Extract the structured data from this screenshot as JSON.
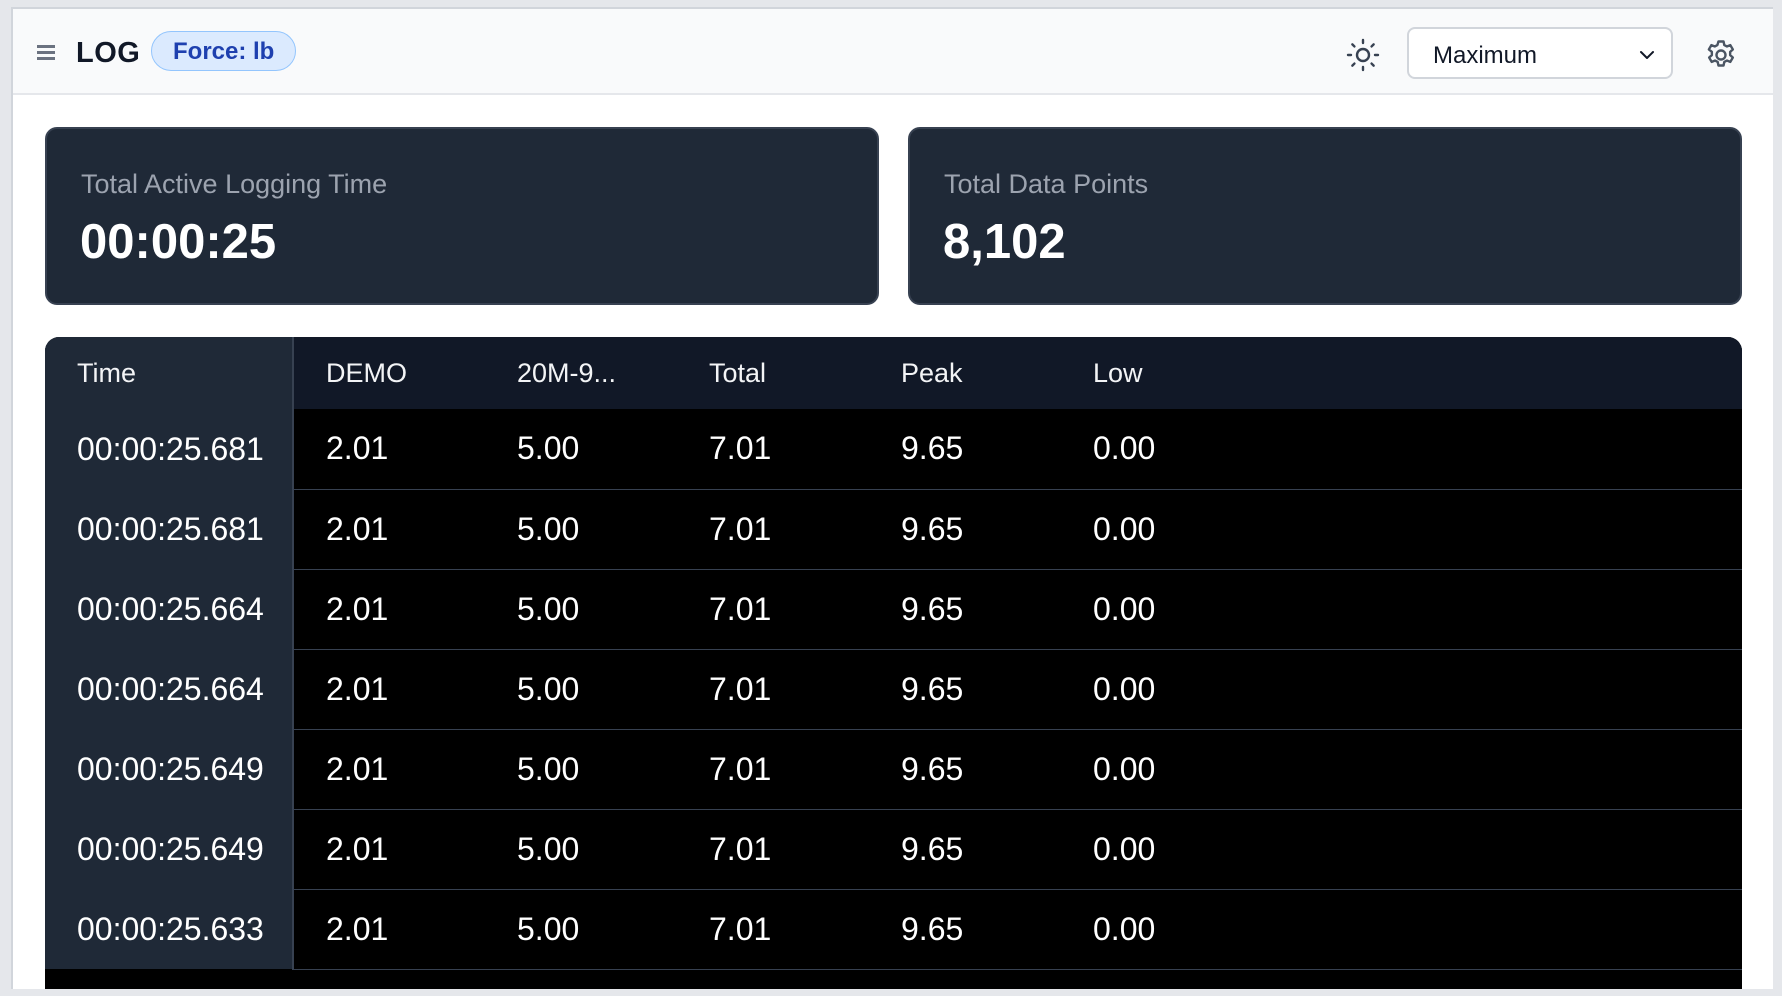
{
  "header": {
    "title": "LOG",
    "unit_badge": "Force: lb",
    "mode_select": {
      "selected": "Maximum"
    },
    "icons": {
      "menu": "menu-icon",
      "theme": "sun-icon",
      "settings": "gear-icon"
    }
  },
  "stats": [
    {
      "label": "Total Active Logging Time",
      "value": "00:00:25"
    },
    {
      "label": "Total Data Points",
      "value": "8,102"
    }
  ],
  "table": {
    "columns": [
      "Time",
      "DEMO",
      "20M-9...",
      "Total",
      "Peak",
      "Low"
    ],
    "rows": [
      [
        "00:00:25.681",
        "2.01",
        "5.00",
        "7.01",
        "9.65",
        "0.00"
      ],
      [
        "00:00:25.681",
        "2.01",
        "5.00",
        "7.01",
        "9.65",
        "0.00"
      ],
      [
        "00:00:25.664",
        "2.01",
        "5.00",
        "7.01",
        "9.65",
        "0.00"
      ],
      [
        "00:00:25.664",
        "2.01",
        "5.00",
        "7.01",
        "9.65",
        "0.00"
      ],
      [
        "00:00:25.649",
        "2.01",
        "5.00",
        "7.01",
        "9.65",
        "0.00"
      ],
      [
        "00:00:25.649",
        "2.01",
        "5.00",
        "7.01",
        "9.65",
        "0.00"
      ],
      [
        "00:00:25.633",
        "2.01",
        "5.00",
        "7.01",
        "9.65",
        "0.00"
      ]
    ]
  },
  "colors": {
    "card_bg": "#1f2937",
    "table_bg": "#000000",
    "badge_bg": "#dbeafe",
    "badge_text": "#1e40af"
  }
}
